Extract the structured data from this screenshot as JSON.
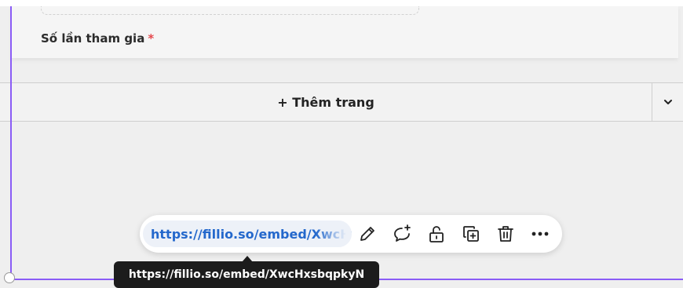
{
  "form": {
    "field_label": "Số lần tham gia",
    "required_mark": "*"
  },
  "add_page": {
    "label": "+ Thêm trang",
    "expand_icon": "chevron-down-icon"
  },
  "embed_toolbar": {
    "url_text": "https://fillio.so/embed/XwcHxsbqpkyN",
    "icons": [
      "pencil-icon",
      "comment-add-icon",
      "unlock-icon",
      "duplicate-icon",
      "trash-icon",
      "more-icon"
    ]
  },
  "tooltip": {
    "text": "https://fillio.so/embed/XwcHxsbqpkyN"
  },
  "colors": {
    "selection": "#8a5cf6",
    "link": "#2468cc",
    "required": "#e5484d",
    "tooltip_bg": "#1c1c1c"
  }
}
